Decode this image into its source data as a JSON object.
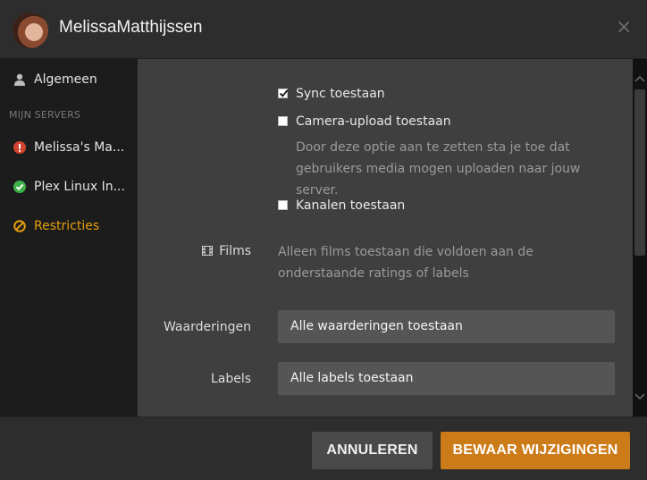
{
  "header": {
    "username": "MelissaMatthijssen",
    "close_icon": "×"
  },
  "sidebar": {
    "general": "Algemeen",
    "section_title": "MIJN SERVERS",
    "servers": [
      {
        "label": "Melissa's Ma...",
        "status": "error",
        "color": "#d0432f"
      },
      {
        "label": "Plex Linux In...",
        "status": "ok",
        "color": "#3fb14b"
      }
    ],
    "restrictions": "Restricties",
    "accent_color": "#e5a00d"
  },
  "main": {
    "sync": {
      "label": "Sync toestaan",
      "checked": true
    },
    "camera_upload": {
      "label": "Camera-upload toestaan",
      "checked": false,
      "description": "Door deze optie aan te zetten sta je toe dat gebruikers media mogen uploaden naar jouw server."
    },
    "channels": {
      "label": "Kanalen toestaan",
      "checked": false
    },
    "films": {
      "label": "Films",
      "description": "Alleen films toestaan die voldoen aan de onderstaande ratings of labels"
    },
    "ratings": {
      "label": "Waarderingen",
      "value": "Alle waarderingen toestaan"
    },
    "labels": {
      "label": "Labels",
      "value": "Alle labels toestaan"
    }
  },
  "footer": {
    "cancel_label": "ANNULEREN",
    "save_label": "BEWAAR WIJZIGINGEN",
    "save_color": "#cc7b19"
  }
}
